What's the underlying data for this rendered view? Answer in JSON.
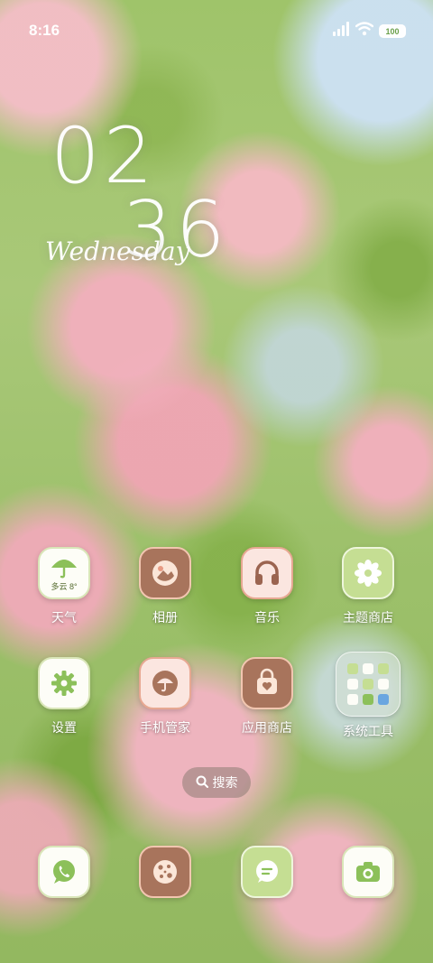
{
  "status_bar": {
    "time": "8:16",
    "battery": "100",
    "icons": [
      "signal-icon",
      "wifi-icon",
      "battery-icon"
    ]
  },
  "clock": {
    "hour": "02",
    "minute": "36",
    "day": "Wednesday"
  },
  "apps_row1": [
    {
      "label": "天气",
      "icon": "weather-umbrella-icon",
      "sub": "多云 8°"
    },
    {
      "label": "相册",
      "icon": "gallery-icon"
    },
    {
      "label": "音乐",
      "icon": "headphones-icon"
    },
    {
      "label": "主题商店",
      "icon": "theme-flower-icon"
    }
  ],
  "apps_row2": [
    {
      "label": "设置",
      "icon": "gear-icon"
    },
    {
      "label": "手机管家",
      "icon": "phone-manager-umbrella-icon"
    },
    {
      "label": "应用商店",
      "icon": "app-store-bag-icon"
    },
    {
      "label": "系统工具",
      "icon": "folder-icon"
    }
  ],
  "search": {
    "label": "搜索",
    "icon": "search-icon"
  },
  "dock": [
    {
      "icon": "phone-icon"
    },
    {
      "icon": "browser-cookie-icon"
    },
    {
      "icon": "messages-icon"
    },
    {
      "icon": "camera-icon"
    }
  ],
  "colors": {
    "icon_white": "#fdfdf7",
    "icon_brown": "#a8745c",
    "icon_pink": "#fbe6e0",
    "icon_green": "#c5de93",
    "icon_accent_green": "#7fb04a"
  }
}
